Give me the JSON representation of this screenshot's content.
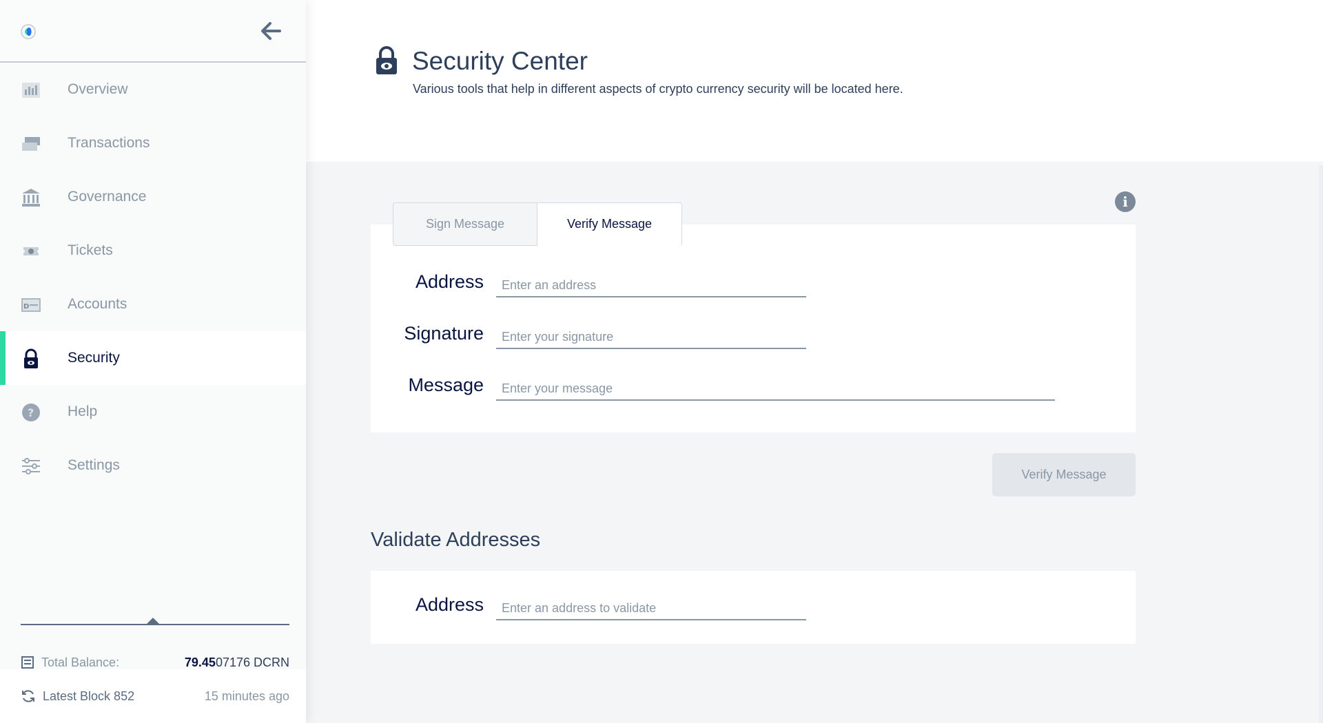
{
  "sidebar": {
    "items": [
      {
        "label": "Overview",
        "icon": "overview-icon"
      },
      {
        "label": "Transactions",
        "icon": "transactions-icon"
      },
      {
        "label": "Governance",
        "icon": "governance-icon"
      },
      {
        "label": "Tickets",
        "icon": "tickets-icon"
      },
      {
        "label": "Accounts",
        "icon": "accounts-icon"
      },
      {
        "label": "Security",
        "icon": "lock-icon",
        "active": true
      },
      {
        "label": "Help",
        "icon": "help-icon"
      },
      {
        "label": "Settings",
        "icon": "settings-icon"
      }
    ],
    "footer": {
      "balance_label": "Total Balance:",
      "balance_main": "79.45",
      "balance_rest": "07176 DCRN",
      "block_label": "Latest Block 852",
      "block_ago": "15 minutes ago"
    }
  },
  "header": {
    "title": "Security Center",
    "subtitle": "Various tools that help in different aspects of crypto currency security will be located here."
  },
  "tabs": [
    {
      "label": "Sign Message",
      "active": false
    },
    {
      "label": "Verify Message",
      "active": true
    }
  ],
  "verify_form": {
    "address_label": "Address",
    "address_placeholder": "Enter an address",
    "signature_label": "Signature",
    "signature_placeholder": "Enter your signature",
    "message_label": "Message",
    "message_placeholder": "Enter your message",
    "submit_label": "Verify Message"
  },
  "validate": {
    "title": "Validate Addresses",
    "address_label": "Address",
    "address_placeholder": "Enter an address to validate"
  },
  "colors": {
    "accent": "#2ed8a3",
    "text_dark": "#091440",
    "text_muted": "#8997a5"
  }
}
